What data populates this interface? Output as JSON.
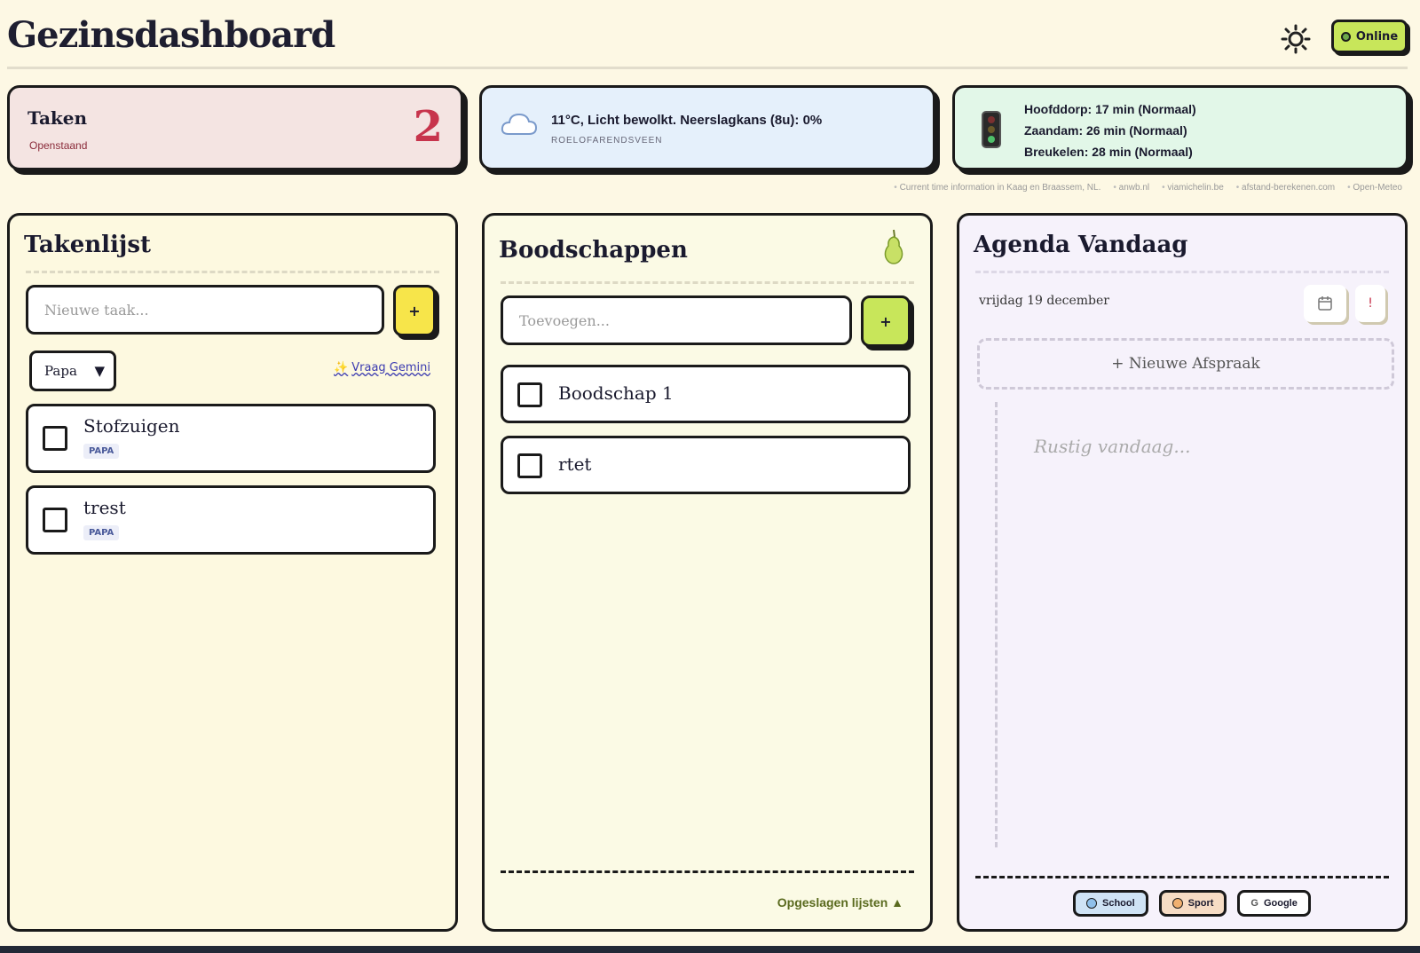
{
  "header": {
    "title": "Gezinsdashboard",
    "status": "Online"
  },
  "stats": {
    "tasks": {
      "label": "Taken",
      "sub": "Openstaand",
      "count": "2"
    },
    "weather": {
      "text": "11°C, Licht bewolkt. Neerslagkans (8u): 0%",
      "location": "ROELOFARENDSVEEN"
    },
    "traffic": {
      "lines": [
        "Hoofddorp: 17 min (Normaal)",
        "Zaandam: 26 min (Normaal)",
        "Breukelen: 28 min (Normaal)"
      ]
    }
  },
  "sources": [
    "Current time information in Kaag en Braassem, NL.",
    "anwb.nl",
    "viamichelin.be",
    "afstand-berekenen.com",
    "Open-Meteo"
  ],
  "tasks_panel": {
    "title": "Takenlijst",
    "input_placeholder": "Nieuwe taak...",
    "add_label": "+",
    "assignee": "Papa",
    "gemini_label": "Vraag Gemini",
    "items": [
      {
        "title": "Stofzuigen",
        "tag": "PAPA"
      },
      {
        "title": "trest",
        "tag": "PAPA"
      }
    ]
  },
  "shop_panel": {
    "title": "Boodschappen",
    "input_placeholder": "Toevoegen...",
    "add_label": "+",
    "items": [
      {
        "title": "Boodschap 1"
      },
      {
        "title": "rtet"
      }
    ],
    "saved_lists": "Opgeslagen lijsten ▲"
  },
  "agenda_panel": {
    "title": "Agenda Vandaag",
    "date": "vrijdag 19 december",
    "alert_label": "!",
    "new_appt": "+ Nieuwe Afspraak",
    "empty": "Rustig vandaag...",
    "calendars": [
      {
        "label": "School",
        "bg": "#cfe3f5",
        "dot": "#8fc0ea"
      },
      {
        "label": "Sport",
        "bg": "#f6dcc4",
        "dot": "#f0b070"
      },
      {
        "label": "Google",
        "bg": "#ffffff",
        "dot": ""
      }
    ]
  },
  "colors": {
    "accent": "#c8e65a",
    "tasks_red": "#c7344c",
    "yellow": "#f7e54a"
  }
}
